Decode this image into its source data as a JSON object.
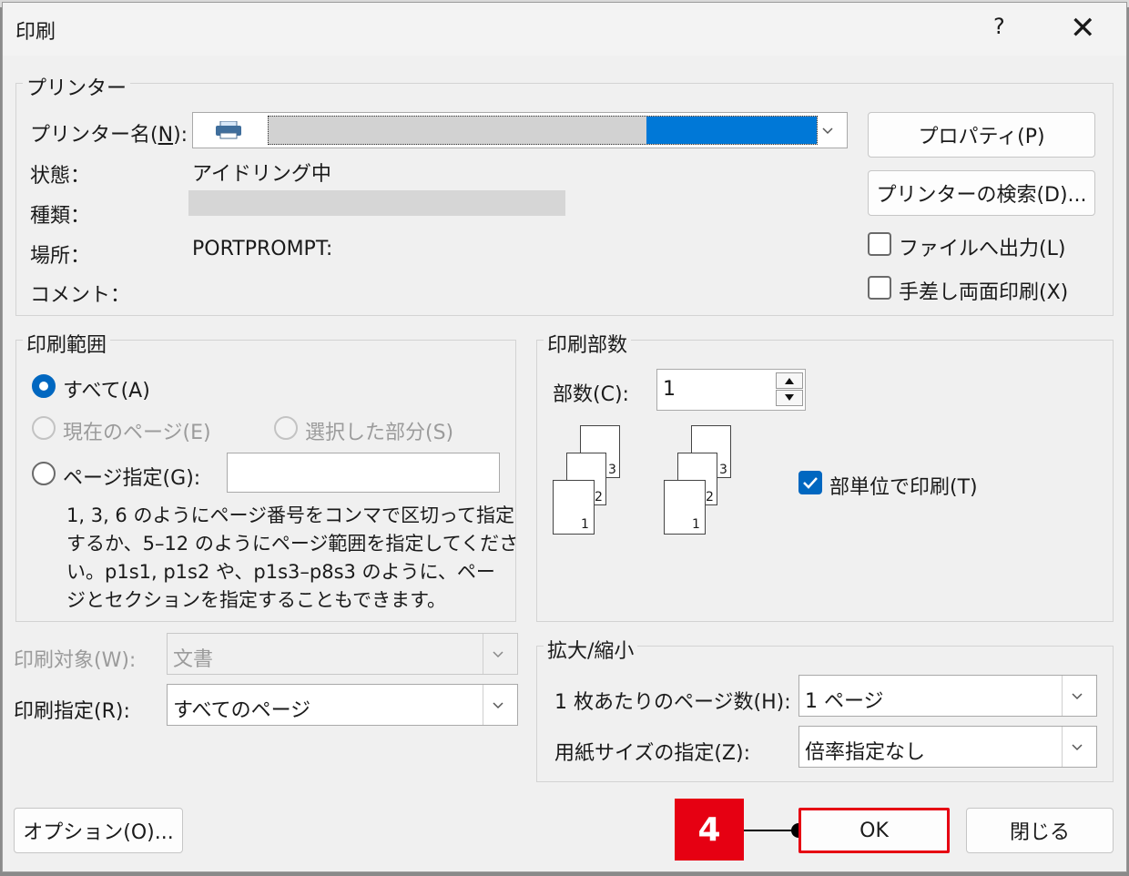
{
  "dialog": {
    "title": "印刷",
    "help_label": "?",
    "close_label": "✕"
  },
  "printer": {
    "group_title": "プリンター",
    "name_label": "プリンター名(",
    "name_key": "N",
    "name_label_end": "):",
    "status_label": "状態：",
    "status_value": "アイドリング中",
    "type_label": "種類：",
    "location_label": "場所：",
    "location_value": "PORTPROMPT:",
    "comment_label": "コメント：",
    "properties_button": "プロパティ(P)",
    "find_button": "プリンターの検索(D)...",
    "print_to_file": "ファイルへ出力(L)",
    "manual_duplex": "手差し両面印刷(X)",
    "print_to_file_checked": false,
    "manual_duplex_checked": false
  },
  "range": {
    "group_title": "印刷範囲",
    "all_label": "すべて(A)",
    "current_label": "現在のページ(E)",
    "selection_label": "選択した部分(S)",
    "pages_label": "ページ指定(G):",
    "pages_value": "",
    "help_line1": "1, 3, 6 のようにページ番号をコンマで区切って指定",
    "help_line2": "するか、5–12 のようにページ範囲を指定してくださ",
    "help_line3": "い。p1s1, p1s2 や、p1s3–p8s3 のように、ペー",
    "help_line4": "ジとセクションを指定することもできます。"
  },
  "copies": {
    "group_title": "印刷部数",
    "count_label": "部数(C):",
    "count_value": "1",
    "collate_label": "部単位で印刷(T)",
    "collate_checked": true,
    "page_numbers": [
      "3",
      "2",
      "1"
    ]
  },
  "print_what": {
    "label": "印刷対象(W):",
    "value": "文書"
  },
  "print_spec": {
    "label": "印刷指定(R):",
    "value": "すべてのページ"
  },
  "zoom": {
    "group_title": "拡大/縮小",
    "pages_per_sheet_label": "1 枚あたりのページ数(H):",
    "pages_per_sheet_value": "1 ページ",
    "scale_label": "用紙サイズの指定(Z):",
    "scale_value": "倍率指定なし"
  },
  "footer": {
    "options_button": "オプション(O)...",
    "ok_button": "OK",
    "close_button": "閉じる"
  },
  "annotation": {
    "step_number": "4",
    "badge_color": "#e60012"
  }
}
